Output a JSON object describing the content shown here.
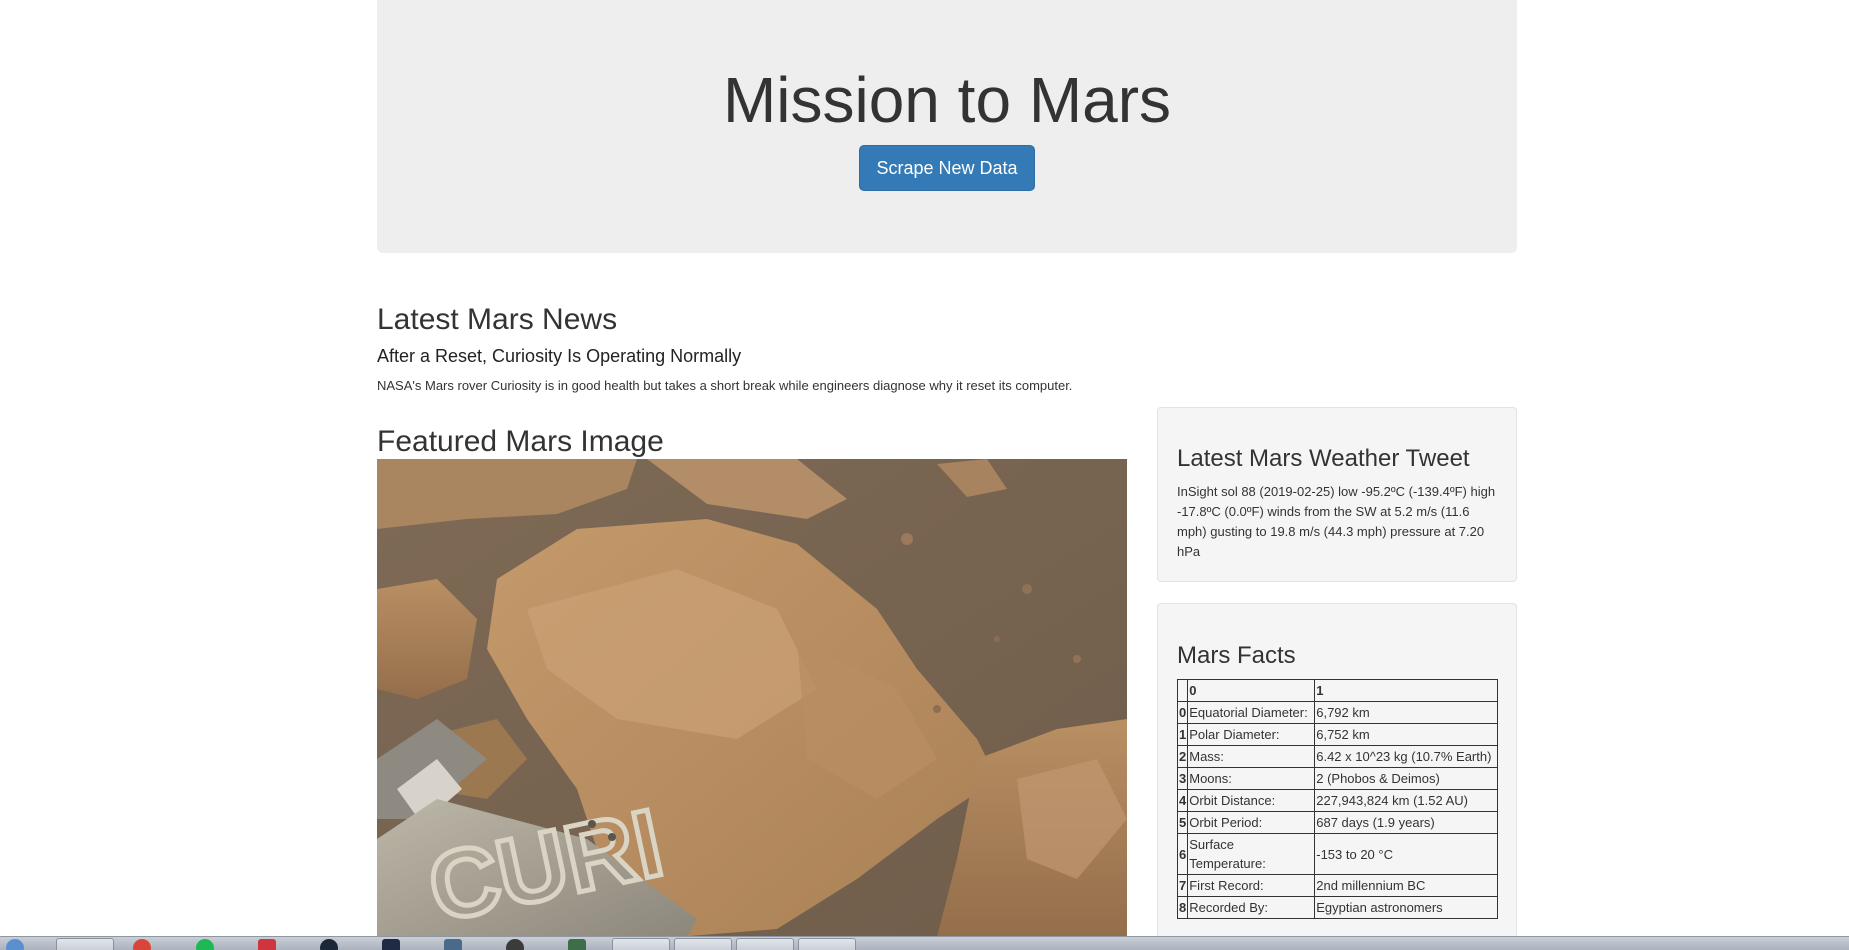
{
  "jumbotron": {
    "title": "Mission to Mars",
    "scrape_button_label": "Scrape New Data"
  },
  "news": {
    "heading": "Latest Mars News",
    "title": "After a Reset, Curiosity Is Operating Normally",
    "paragraph": "NASA's Mars rover Curiosity is in good health but takes a short break while engineers diagnose why it reset its computer."
  },
  "featured": {
    "heading": "Featured Mars Image"
  },
  "weather": {
    "heading": "Latest Mars Weather Tweet",
    "text": "InSight sol 88 (2019-02-25) low -95.2ºC (-139.4ºF) high -17.8ºC (0.0ºF) winds from the SW at 5.2 m/s (11.6 mph) gusting to 19.8 m/s (44.3 mph) pressure at 7.20 hPa"
  },
  "facts": {
    "heading": "Mars Facts",
    "columns": [
      "0",
      "1"
    ],
    "rows": [
      {
        "index": "0",
        "label": "Equatorial Diameter:",
        "value": "6,792 km"
      },
      {
        "index": "1",
        "label": "Polar Diameter:",
        "value": "6,752 km"
      },
      {
        "index": "2",
        "label": "Mass:",
        "value": "6.42 x 10^23 kg (10.7% Earth)"
      },
      {
        "index": "3",
        "label": "Moons:",
        "value": "2 (Phobos & Deimos)"
      },
      {
        "index": "4",
        "label": "Orbit Distance:",
        "value": "227,943,824 km (1.52 AU)"
      },
      {
        "index": "5",
        "label": "Orbit Period:",
        "value": "687 days (1.9 years)"
      },
      {
        "index": "6",
        "label": "Surface Temperature:",
        "value": "-153 to 20 °C"
      },
      {
        "index": "7",
        "label": "First Record:",
        "value": "2nd millennium BC"
      },
      {
        "index": "8",
        "label": "Recorded By:",
        "value": "Egyptian astronomers"
      }
    ]
  },
  "colors": {
    "jumbotron_bg": "#eeeeee",
    "button_primary": "#337ab7",
    "panel_bg": "#f5f5f5"
  }
}
